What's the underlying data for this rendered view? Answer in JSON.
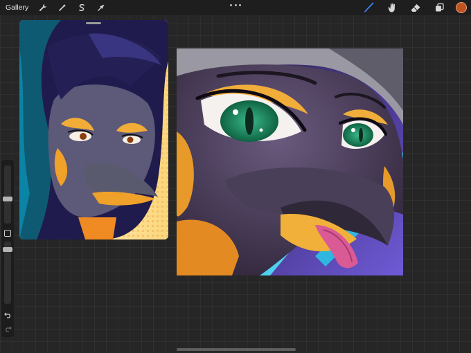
{
  "topbar": {
    "gallery_label": "Gallery",
    "left_tools": [
      {
        "name": "actions",
        "icon": "wrench-icon"
      },
      {
        "name": "adjustments",
        "icon": "magic-wand-icon"
      },
      {
        "name": "selection",
        "icon": "s-curve-icon"
      },
      {
        "name": "transform",
        "icon": "arrow-cursor-icon"
      }
    ],
    "more_icon": "more-dots-icon",
    "right_tools": [
      {
        "name": "brush",
        "icon": "brush-icon",
        "active": true
      },
      {
        "name": "smudge",
        "icon": "smudge-icon",
        "active": false
      },
      {
        "name": "eraser",
        "icon": "eraser-icon",
        "active": false
      },
      {
        "name": "layers",
        "icon": "layers-icon",
        "active": false
      }
    ],
    "current_color": "#c0531f"
  },
  "sidebar": {
    "brush_size_icon": "slider-thumb",
    "opacity_icon": "slider-thumb",
    "modify_icon": "square-icon",
    "undo_icon": "undo-icon",
    "redo_icon": "redo-icon"
  },
  "colors": {
    "accent": "#3b82f6",
    "toolbar_bg": "#1e1e1e",
    "canvas_bg": "#262626"
  }
}
